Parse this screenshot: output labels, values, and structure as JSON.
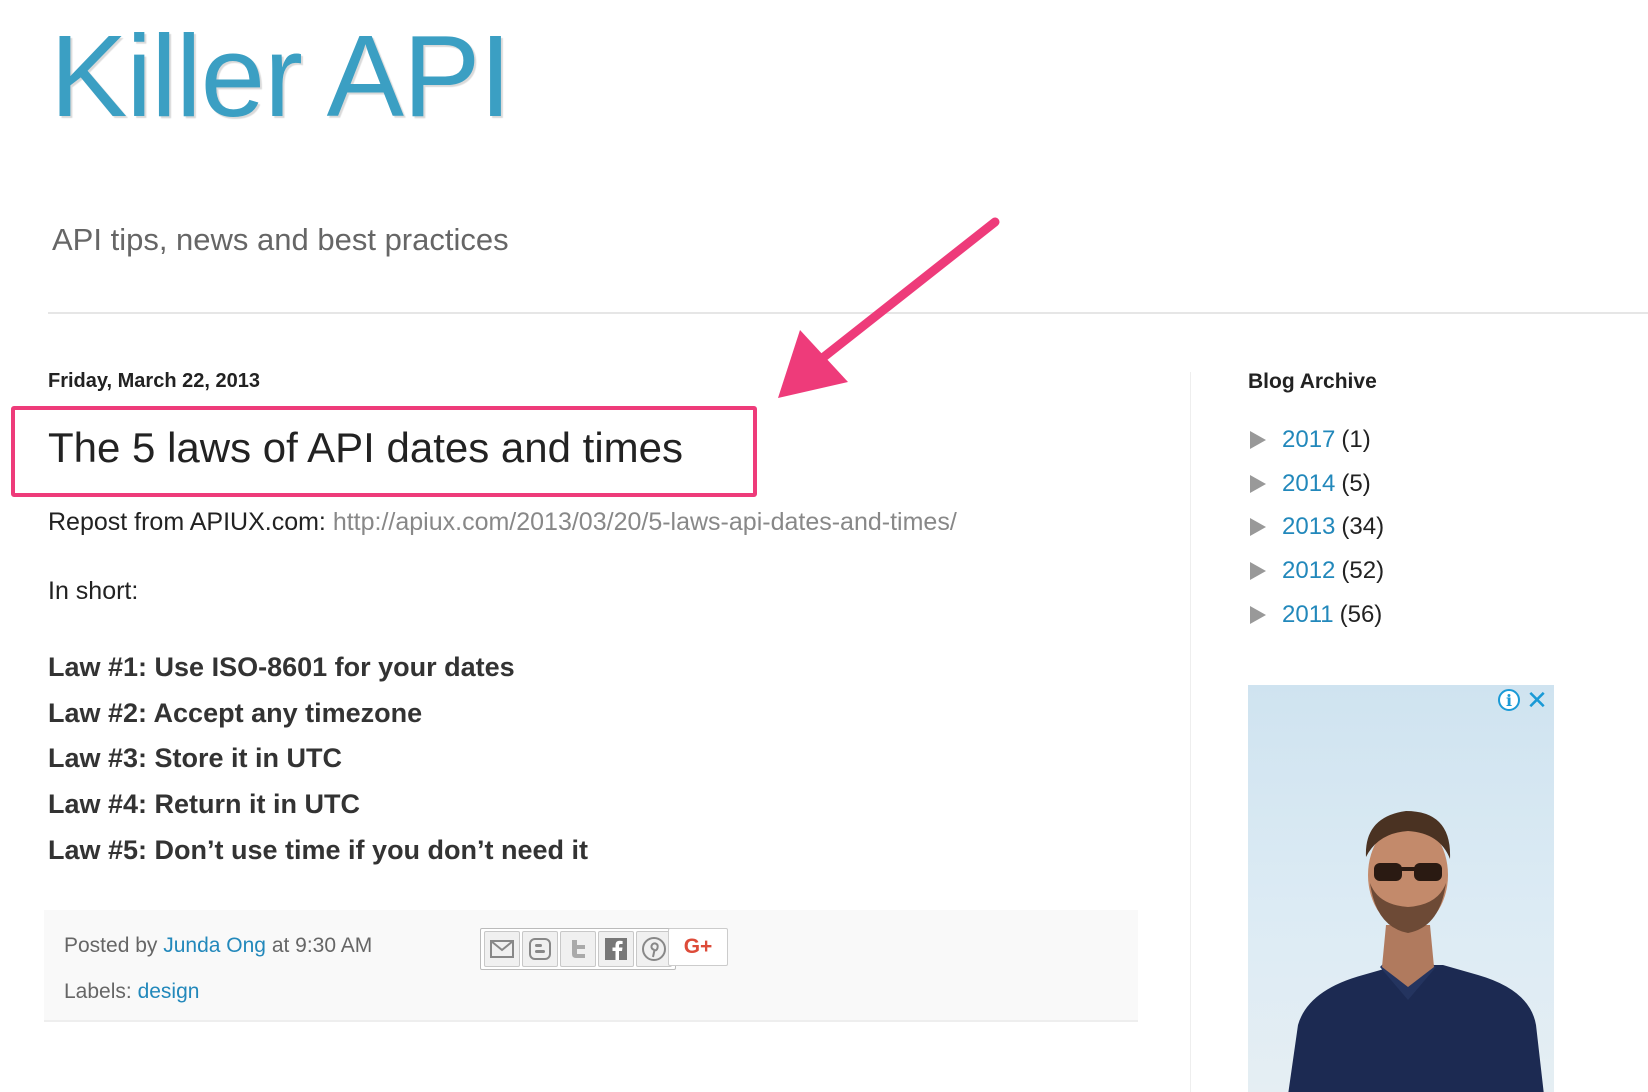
{
  "header": {
    "title": "Killer API",
    "description": "API tips, news and best practices"
  },
  "post": {
    "date": "Friday, March 22, 2013",
    "title": "The 5 laws of API dates and times",
    "repost_prefix": "Repost from APIUX.com: ",
    "repost_link": "http://apiux.com/2013/03/20/5-laws-api-dates-and-times/",
    "in_short": "In short:",
    "laws": [
      "Law #1: Use ISO-8601 for your dates",
      "Law #2: Accept any timezone",
      "Law #3: Store it in UTC",
      "Law #4: Return it in UTC",
      "Law #5: Don’t use time if you don’t need it"
    ]
  },
  "footer": {
    "posted_by_prefix": "Posted by ",
    "author": "Junda Ong",
    "at_text": " at ",
    "time": "9:30 AM",
    "labels_prefix": "Labels: ",
    "label": "design",
    "share_icons": [
      "email-icon",
      "blogger-icon",
      "twitter-icon",
      "facebook-icon",
      "pinterest-icon"
    ],
    "gplus_label": "G+"
  },
  "sidebar": {
    "archive_title": "Blog Archive",
    "archive": [
      {
        "year": "2017",
        "count": "(1)"
      },
      {
        "year": "2014",
        "count": "(5)"
      },
      {
        "year": "2013",
        "count": "(34)"
      },
      {
        "year": "2012",
        "count": "(52)"
      },
      {
        "year": "2011",
        "count": "(56)"
      }
    ]
  },
  "ad": {
    "info_glyph": "i",
    "close_glyph": "✕"
  },
  "colors": {
    "title_blue": "#3b9fc3",
    "link_blue": "#2288bb",
    "highlight_pink": "#ee3b7a"
  }
}
